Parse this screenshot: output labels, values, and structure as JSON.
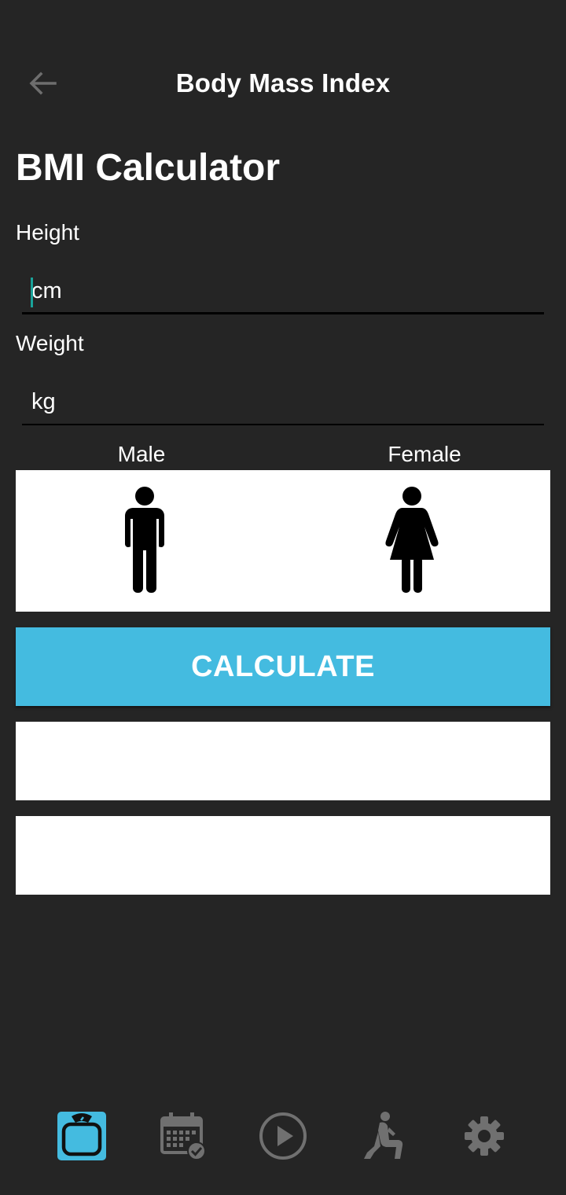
{
  "header": {
    "title": "Body Mass Index"
  },
  "page_title": "BMI Calculator",
  "height": {
    "label": "Height",
    "placeholder": "cm",
    "value": ""
  },
  "weight": {
    "label": "Weight",
    "placeholder": "kg",
    "value": ""
  },
  "gender": {
    "male_label": "Male",
    "female_label": "Female"
  },
  "calculate_label": "CALCULATE",
  "results": {
    "result_1": "",
    "result_2": ""
  },
  "nav": {
    "items": [
      {
        "icon": "scale-icon",
        "active": true
      },
      {
        "icon": "calendar-check-icon",
        "active": false
      },
      {
        "icon": "play-circle-icon",
        "active": false
      },
      {
        "icon": "exercise-icon",
        "active": false
      },
      {
        "icon": "gear-icon",
        "active": false
      }
    ]
  },
  "colors": {
    "background": "#252525",
    "accent": "#44bbe0",
    "inactive_icon": "#707070",
    "caret": "#1aa39a"
  }
}
